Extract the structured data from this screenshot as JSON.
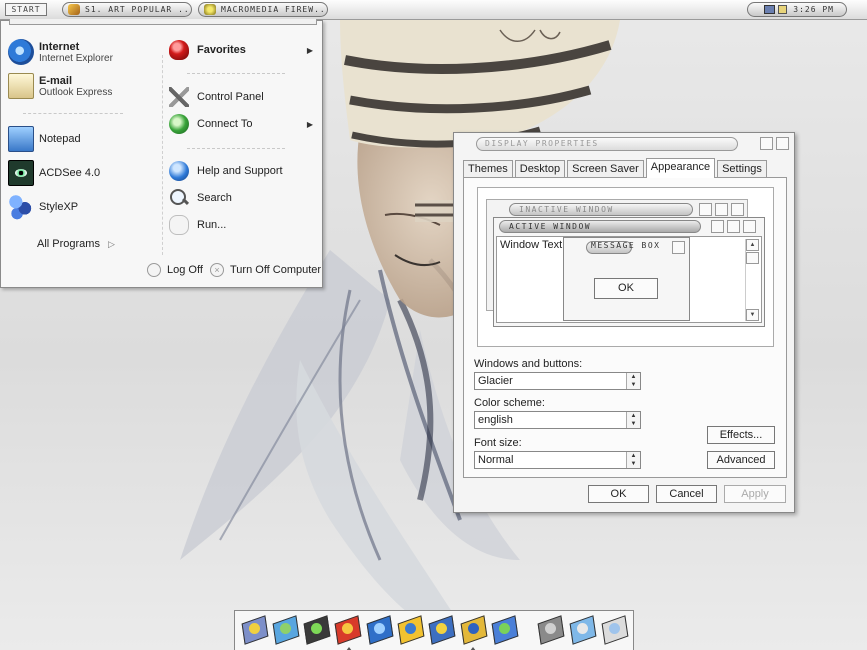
{
  "taskbar": {
    "start_label": "START",
    "tasks": [
      {
        "label": "S1. ART POPULAR ..."
      },
      {
        "label": "MACROMEDIA FIREW..."
      }
    ],
    "clock": "3:26 PM"
  },
  "start_menu": {
    "pinned": [
      {
        "title": "Internet",
        "subtitle": "Internet Explorer",
        "icon": "internet-explorer-icon"
      },
      {
        "title": "E-mail",
        "subtitle": "Outlook Express",
        "icon": "outlook-express-icon"
      }
    ],
    "recent": [
      {
        "label": "Notepad",
        "icon": "notepad-icon"
      },
      {
        "label": "ACDSee 4.0",
        "icon": "acdsee-icon"
      },
      {
        "label": "StyleXP",
        "icon": "stylexp-icon"
      }
    ],
    "all_programs": "All Programs",
    "right": [
      {
        "label": "Favorites",
        "icon": "favorites-icon",
        "bold": true,
        "submenu": true
      },
      {
        "label": "Control Panel",
        "icon": "control-panel-icon"
      },
      {
        "label": "Connect To",
        "icon": "connect-to-icon",
        "submenu": true
      },
      {
        "label": "Help and Support",
        "icon": "help-icon"
      },
      {
        "label": "Search",
        "icon": "search-icon"
      },
      {
        "label": "Run...",
        "icon": "run-icon"
      }
    ],
    "log_off": "Log Off",
    "turn_off": "Turn Off Computer"
  },
  "display_properties": {
    "title": "DISPLAY PROPERTIES",
    "tabs": [
      "Themes",
      "Desktop",
      "Screen Saver",
      "Appearance",
      "Settings"
    ],
    "active_tab": "Appearance",
    "preview": {
      "inactive_title": "INACTIVE WINDOW",
      "active_title": "ACTIVE WINDOW",
      "window_text": "Window Text",
      "message_box_title": "MESSAGE BOX",
      "ok": "OK"
    },
    "windows_and_buttons": {
      "label": "Windows and buttons:",
      "value": "Glacier"
    },
    "color_scheme": {
      "label": "Color scheme:",
      "value": "english"
    },
    "font_size": {
      "label": "Font size:",
      "value": "Normal"
    },
    "effects_button": "Effects...",
    "advanced_button": "Advanced",
    "ok_button": "OK",
    "cancel_button": "Cancel",
    "apply_button": "Apply"
  },
  "dock": {
    "icons": [
      {
        "name": "dock-icon-1",
        "c1": "#7d8fc9",
        "c2": "#f0d040"
      },
      {
        "name": "dock-icon-2",
        "c1": "#58a6e0",
        "c2": "#8fd06a"
      },
      {
        "name": "dock-icon-3",
        "c1": "#3a3a3a",
        "c2": "#7ed957"
      },
      {
        "name": "dock-icon-4",
        "c1": "#d83a2a",
        "c2": "#f6c640"
      },
      {
        "name": "dock-icon-5",
        "c1": "#2f6fc8",
        "c2": "#9fd0ff"
      },
      {
        "name": "dock-icon-6",
        "c1": "#f2c230",
        "c2": "#3a7ad0"
      },
      {
        "name": "dock-icon-7",
        "c1": "#3d6fc0",
        "c2": "#f2d240"
      },
      {
        "name": "dock-icon-8",
        "c1": "#e3b83a",
        "c2": "#2e62c0"
      },
      {
        "name": "dock-icon-9",
        "c1": "#4a7fd8",
        "c2": "#7ad15a"
      },
      {
        "name": "dock-icon-10",
        "c1": "#8a8a8a",
        "c2": "#d0d0d0"
      },
      {
        "name": "dock-icon-11",
        "c1": "#7fb8e8",
        "c2": "#e8e8e8"
      },
      {
        "name": "dock-icon-12",
        "c1": "#dcdcdc",
        "c2": "#9fc4ec"
      }
    ]
  }
}
